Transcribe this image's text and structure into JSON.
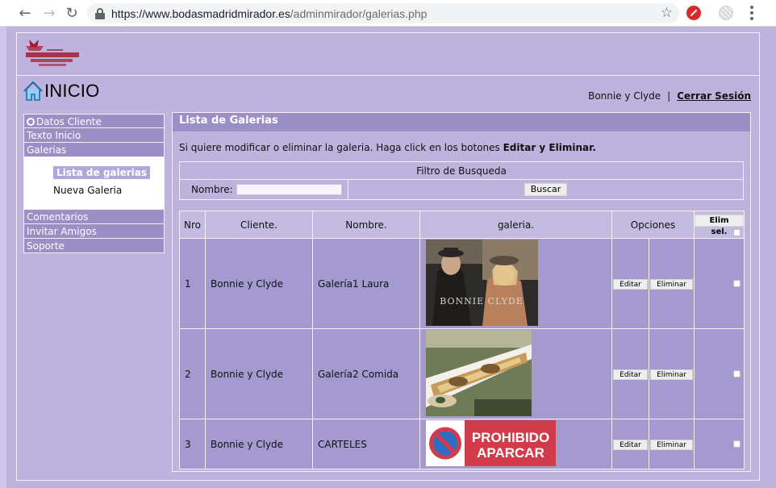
{
  "browser": {
    "url_host": "https://www.bodasmadridmirador.es",
    "url_path": "/adminmirador/galerias.php"
  },
  "header": {
    "logo_alt": "Mirador de Cuatrovientos",
    "home_title": "INICIO",
    "user_name": "Bonnie y Clyde",
    "separator": "|",
    "logout_label": "Cerrar Sesión"
  },
  "sidebar": {
    "items": [
      {
        "label": "Datos Cliente"
      },
      {
        "label": "Texto Inicio"
      },
      {
        "label": "Galerias"
      }
    ],
    "sub_items": [
      {
        "label": "Lista de galerias"
      },
      {
        "label": "Nueva Galeria"
      }
    ],
    "items_after": [
      {
        "label": "Comentarios"
      },
      {
        "label": "Invitar Amigos"
      },
      {
        "label": "Soporte"
      }
    ]
  },
  "main": {
    "title": "Lista de Galerias",
    "info_text": "Si quiere modificar o eliminar la galeria. Haga click en los botones ",
    "info_bold": "Editar y Eliminar.",
    "filter": {
      "title": "Filtro de Busqueda",
      "name_label": "Nombre:",
      "name_value": "",
      "search_label": "Buscar"
    },
    "table": {
      "headers": [
        "Nro",
        "Cliente.",
        "Nombre.",
        "galeria.",
        "Opciones"
      ],
      "elim_sel_label": "Elim sel.",
      "edit_label": "Editar",
      "delete_label": "Eliminar",
      "rows": [
        {
          "nro": "1",
          "cliente": "Bonnie y Clyde",
          "nombre": "Galería1 Laura",
          "image_text": "BONNIE CLYDE"
        },
        {
          "nro": "2",
          "cliente": "Bonnie y Clyde",
          "nombre": "Galería2 Comida",
          "image_text": ""
        },
        {
          "nro": "3",
          "cliente": "Bonnie y Clyde",
          "nombre": "CARTELES",
          "image_text_1": "PROHIBIDO",
          "image_text_2": "APARCAR"
        }
      ]
    }
  },
  "colors": {
    "background": "#cdc6ea",
    "panel": "#bdb3dd",
    "header_bar": "#9a8fc6",
    "cell": "#a59ad0",
    "sign_red": "#d23b4a",
    "sign_blue": "#2f6dc4"
  }
}
